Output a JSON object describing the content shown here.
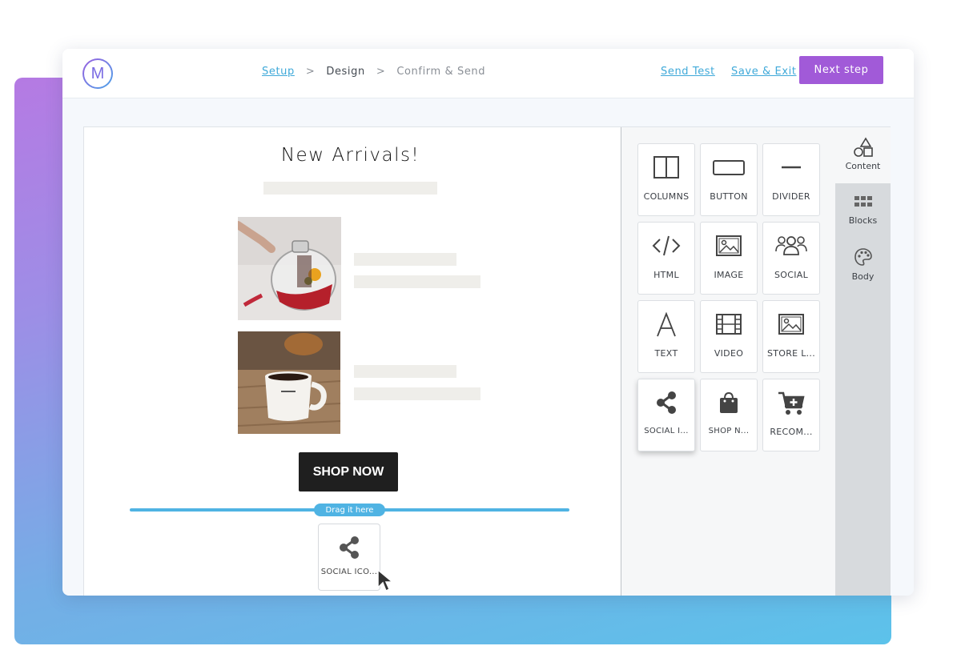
{
  "header": {
    "logo_letter": "M",
    "breadcrumbs": {
      "setup": "Setup",
      "design": "Design",
      "confirm": "Confirm & Send",
      "separator": ">"
    },
    "send_test_label": "Send Test",
    "save_exit_label": "Save & Exit",
    "next_step_label": "Next step"
  },
  "email": {
    "title": "New Arrivals!",
    "shop_button_label": "SHOP NOW",
    "drop_hint": "Drag it here",
    "dragged_block_label": "SOCIAL ICO..."
  },
  "content_blocks": [
    {
      "label": "COLUMNS",
      "icon": "columns-icon"
    },
    {
      "label": "BUTTON",
      "icon": "button-icon"
    },
    {
      "label": "DIVIDER",
      "icon": "divider-icon"
    },
    {
      "label": "HTML",
      "icon": "html-code-icon"
    },
    {
      "label": "IMAGE",
      "icon": "image-icon"
    },
    {
      "label": "SOCIAL",
      "icon": "social-people-icon"
    },
    {
      "label": "TEXT",
      "icon": "text-icon"
    },
    {
      "label": "VIDEO",
      "icon": "video-film-icon"
    },
    {
      "label": "STORE L...",
      "icon": "store-image-icon"
    },
    {
      "label": "SOCIAL I...",
      "icon": "share-icon"
    },
    {
      "label": "SHOP N...",
      "icon": "shopping-bag-icon"
    },
    {
      "label": "RECOM...",
      "icon": "cart-plus-icon"
    }
  ],
  "side_tabs": [
    {
      "label": "Content",
      "icon": "shapes-icon"
    },
    {
      "label": "Blocks",
      "icon": "grid-icon"
    },
    {
      "label": "Body",
      "icon": "palette-icon"
    }
  ],
  "colors": {
    "accent_purple": "#a15ad8",
    "link_blue": "#3fa9d9",
    "drop_blue": "#4fb3e3",
    "button_dark": "#1f1f1f"
  }
}
